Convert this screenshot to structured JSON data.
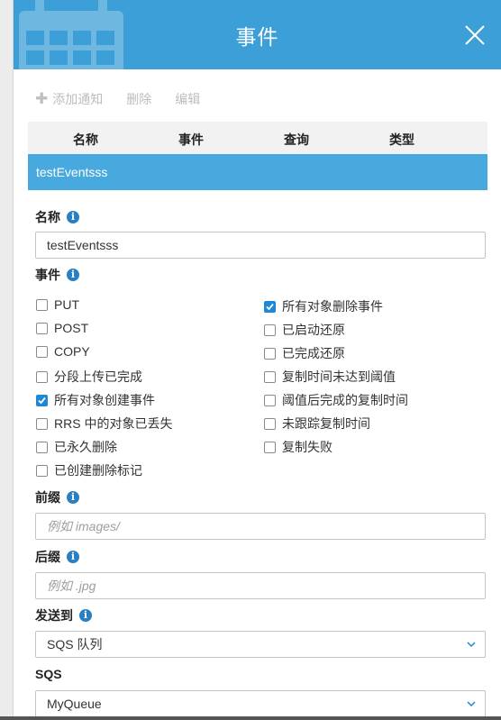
{
  "header": {
    "title": "事件"
  },
  "toolbar": {
    "add_label": "添加通知",
    "delete_label": "删除",
    "edit_label": "编辑"
  },
  "table": {
    "columns": [
      "名称",
      "事件",
      "查询",
      "类型"
    ],
    "selected_row": "testEventsss"
  },
  "form": {
    "name_label": "名称",
    "name_value": "testEventsss",
    "events_label": "事件",
    "events_left": [
      {
        "label": "PUT",
        "checked": false
      },
      {
        "label": "POST",
        "checked": false
      },
      {
        "label": "COPY",
        "checked": false
      },
      {
        "label": "分段上传已完成",
        "checked": false
      },
      {
        "label": "所有对象创建事件",
        "checked": true
      },
      {
        "label": "RRS 中的对象已丢失",
        "checked": false
      },
      {
        "label": "已永久删除",
        "checked": false
      },
      {
        "label": "已创建删除标记",
        "checked": false
      }
    ],
    "events_right": [
      {
        "label": "所有对象删除事件",
        "checked": true
      },
      {
        "label": "已启动还原",
        "checked": false
      },
      {
        "label": "已完成还原",
        "checked": false
      },
      {
        "label": "复制时间未达到阈值",
        "checked": false
      },
      {
        "label": "阈值后完成的复制时间",
        "checked": false
      },
      {
        "label": "未跟踪复制时间",
        "checked": false
      },
      {
        "label": "复制失败",
        "checked": false
      }
    ],
    "prefix_label": "前缀",
    "prefix_placeholder": "例如 images/",
    "suffix_label": "后缀",
    "suffix_placeholder": "例如 .jpg",
    "send_to_label": "发送到",
    "send_to_value": "SQS 队列",
    "sqs_label": "SQS",
    "sqs_value": "MyQueue"
  }
}
